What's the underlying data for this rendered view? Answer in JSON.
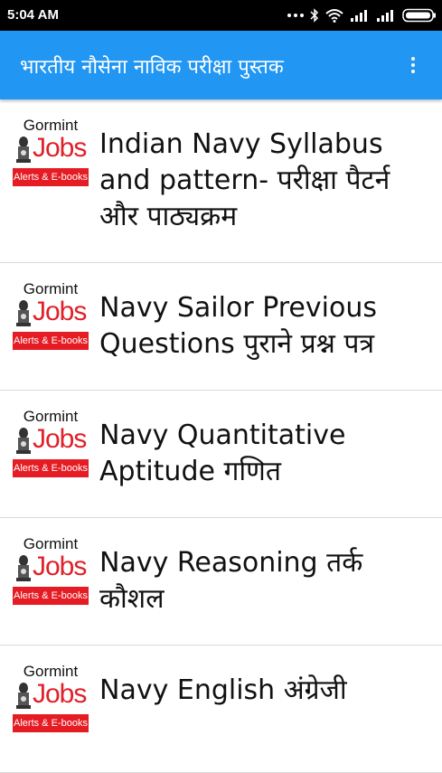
{
  "status_bar": {
    "time": "5:04 AM"
  },
  "app_bar": {
    "title": "भारतीय नौसेना नाविक परीक्षा पुस्तक"
  },
  "logo": {
    "top": "Gormint",
    "main": "Jobs",
    "band": "Alerts & E-books"
  },
  "items": [
    {
      "label": "Indian Navy Syllabus and pattern- परीक्षा पैटर्न और पाठ्यक्रम"
    },
    {
      "label": "Navy Sailor Previous Questions पुराने प्रश्न पत्र"
    },
    {
      "label": "Navy Quantitative Aptitude गणित"
    },
    {
      "label": "Navy Reasoning तर्क कौशल"
    },
    {
      "label": "Navy English अंग्रेजी"
    }
  ],
  "colors": {
    "app_bar": "#2196F3",
    "status_bar": "#000000",
    "logo_red": "#e51c23"
  }
}
